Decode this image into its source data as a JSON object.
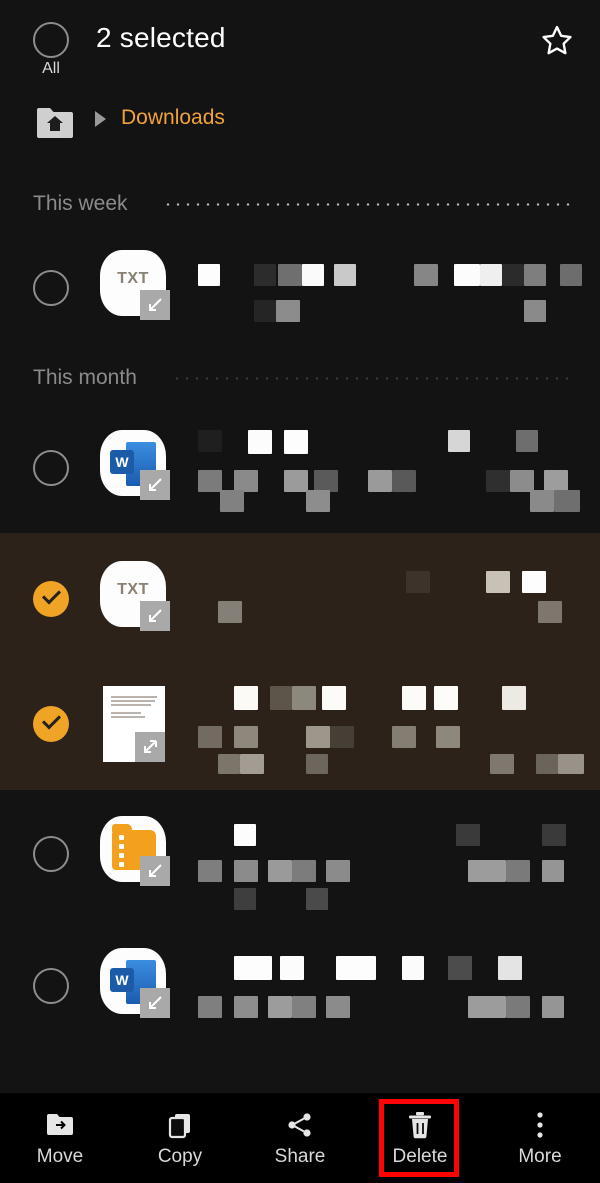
{
  "app": {
    "theme": "dark",
    "background_color": "#131313",
    "accent_color": "#f0a33b",
    "selected_row_color": "#2c2219",
    "highlight_color": "#ff0202"
  },
  "header": {
    "title": "2 selected",
    "select_all_label": "All",
    "select_all_checked": false,
    "favorite_icon": "star-outline-icon"
  },
  "breadcrumb": {
    "home_icon": "home-folder-icon",
    "separator_icon": "chevron-right-icon",
    "current": "Downloads"
  },
  "sections": [
    {
      "title": "This week",
      "dots": "bright"
    },
    {
      "title": "This month",
      "dots": "faint"
    }
  ],
  "files": [
    {
      "section": "This week",
      "icon": "txt-file-icon",
      "icon_label": "TXT",
      "selected": false,
      "name_redacted": true
    },
    {
      "section": "This month",
      "icon": "word-doc-icon",
      "icon_label": "W",
      "selected": false,
      "name_redacted": true
    },
    {
      "section": "This month",
      "icon": "txt-file-icon",
      "icon_label": "TXT",
      "selected": true,
      "name_redacted": true
    },
    {
      "section": "This month",
      "icon": "document-thumbnail-icon",
      "icon_label": "",
      "selected": true,
      "name_redacted": true
    },
    {
      "section": "This month",
      "icon": "zip-archive-icon",
      "icon_label": "",
      "selected": false,
      "name_redacted": true
    },
    {
      "section": "This month",
      "icon": "word-doc-icon",
      "icon_label": "W",
      "selected": false,
      "name_redacted": true
    }
  ],
  "toolbar": {
    "items": [
      {
        "label": "Move",
        "icon": "move-folder-icon",
        "highlighted": false
      },
      {
        "label": "Copy",
        "icon": "copy-pages-icon",
        "highlighted": false
      },
      {
        "label": "Share",
        "icon": "share-nodes-icon",
        "highlighted": false
      },
      {
        "label": "Delete",
        "icon": "trash-can-icon",
        "highlighted": true
      },
      {
        "label": "More",
        "icon": "more-vertical-icon",
        "highlighted": false
      }
    ]
  }
}
